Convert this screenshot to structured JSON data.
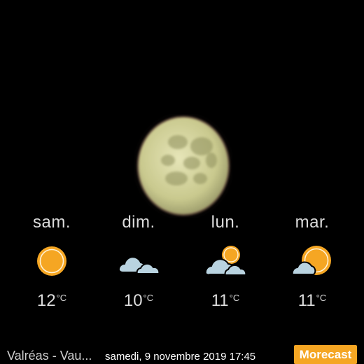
{
  "forecast": [
    {
      "day": "sam.",
      "temp": "12",
      "unit": "°C",
      "icon": "sun-icon"
    },
    {
      "day": "dim.",
      "temp": "10",
      "unit": "°C",
      "icon": "cloud-icon"
    },
    {
      "day": "lun.",
      "temp": "11",
      "unit": "°C",
      "icon": "cloud-sun-icon"
    },
    {
      "day": "mar.",
      "temp": "11",
      "unit": "°C",
      "icon": "sun-cloud-icon"
    }
  ],
  "footer": {
    "location": "Valréas - Vau...",
    "datetime": "samedi, 9 novembre 2019 17:45",
    "brand": "Morecast"
  },
  "colors": {
    "background": "#000000",
    "sun": "#f5a623",
    "cloud": "#b9d3e0",
    "brand": "#f5a623",
    "text": "#dcdcdc"
  }
}
